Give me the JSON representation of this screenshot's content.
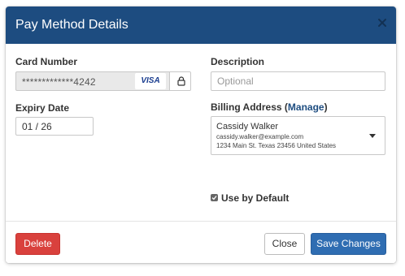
{
  "modal": {
    "title": "Pay Method Details"
  },
  "card": {
    "label": "Card Number",
    "number": "*************4242",
    "brand": "VISA"
  },
  "expiry": {
    "label": "Expiry Date",
    "value": "01 / 26"
  },
  "description": {
    "label": "Description",
    "placeholder": "Optional",
    "value": ""
  },
  "billing": {
    "label": "Billing Address",
    "manage_open": "(",
    "manage_label": "Manage",
    "manage_close": ")",
    "selected": {
      "name": "Cassidy Walker",
      "email": "cassidy.walker@example.com",
      "address": "1234 Main St. Texas 23456 United States"
    }
  },
  "default": {
    "label": "Use by Default",
    "checked": true
  },
  "footer": {
    "delete_label": "Delete",
    "close_label": "Close",
    "save_label": "Save Changes"
  },
  "colors": {
    "header": "#1d4c80",
    "delete": "#d9413d",
    "save": "#2f6db2",
    "link": "#1d4c80"
  },
  "icons": {
    "close": "close-icon",
    "lock": "lock-icon",
    "dropdown": "chevron-down-icon",
    "checkbox": "check-icon"
  }
}
